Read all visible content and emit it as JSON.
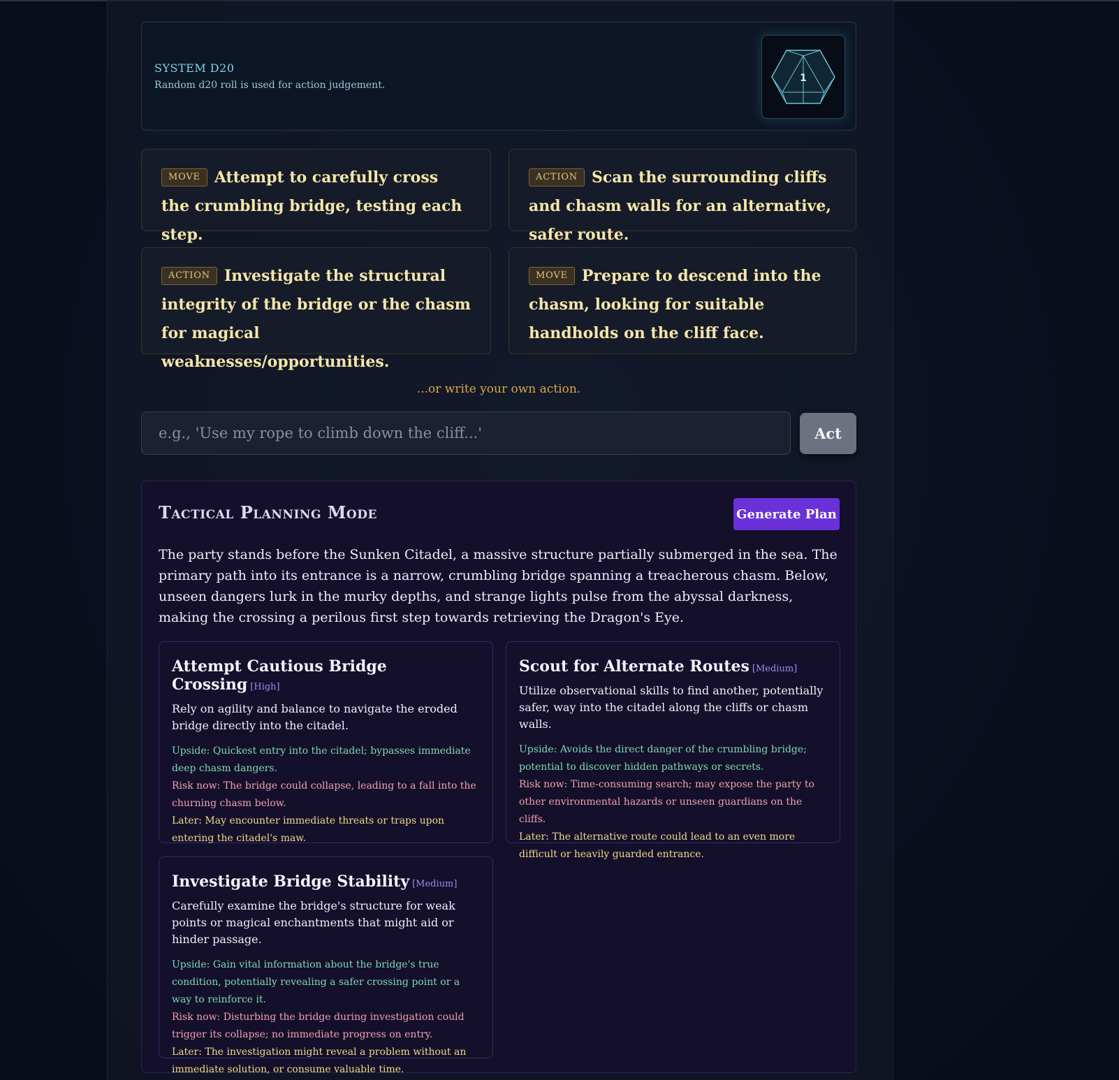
{
  "dice": {
    "title": "SYSTEM D20",
    "subtitle": "Random d20 roll is used for action judgement.",
    "icon": "d20-icon",
    "face_value": "1"
  },
  "options": [
    {
      "tag": "MOVE",
      "text": "Attempt to carefully cross the crumbling bridge, testing each step."
    },
    {
      "tag": "ACTION",
      "text": "Scan the surrounding cliffs and chasm walls for an alternative, safer route."
    },
    {
      "tag": "ACTION",
      "text": "Investigate the structural integrity of the bridge or the chasm for magical weaknesses/opportunities."
    },
    {
      "tag": "MOVE",
      "text": "Prepare to descend into the chasm, looking for suitable handholds on the cliff face."
    }
  ],
  "custom_action": {
    "prompt": "...or write your own action.",
    "placeholder": "e.g., 'Use my rope to climb down the cliff...'",
    "button_label": "Act"
  },
  "tactical": {
    "title": "Tactical Planning Mode",
    "button_label": "Generate Plan",
    "description": "The party stands before the Sunken Citadel, a massive structure partially submerged in the sea. The primary path into its entrance is a narrow, crumbling bridge spanning a treacherous chasm. Below, unseen dangers lurk in the murky depths, and strange lights pulse from the abyssal darkness, making the crossing a perilous first step towards retrieving the Dragon's Eye.",
    "plans": [
      {
        "title": "Attempt Cautious Bridge Crossing",
        "priority": "[High]",
        "description": "Rely on agility and balance to navigate the eroded bridge directly into the citadel.",
        "upside": "Upside: Quickest entry into the citadel; bypasses immediate deep chasm dangers.",
        "risk": "Risk now: The bridge could collapse, leading to a fall into the churning chasm below.",
        "later": "Later: May encounter immediate threats or traps upon entering the citadel's maw."
      },
      {
        "title": "Scout for Alternate Routes",
        "priority": "[Medium]",
        "description": "Utilize observational skills to find another, potentially safer, way into the citadel along the cliffs or chasm walls.",
        "upside": "Upside: Avoids the direct danger of the crumbling bridge; potential to discover hidden pathways or secrets.",
        "risk": "Risk now: Time-consuming search; may expose the party to other environmental hazards or unseen guardians on the cliffs.",
        "later": "Later: The alternative route could lead to an even more difficult or heavily guarded entrance."
      },
      {
        "title": "Investigate Bridge Stability",
        "priority": "[Medium]",
        "description": "Carefully examine the bridge's structure for weak points or magical enchantments that might aid or hinder passage.",
        "upside": "Upside: Gain vital information about the bridge's true condition, potentially revealing a safer crossing point or a way to reinforce it.",
        "risk": "Risk now: Disturbing the bridge during investigation could trigger its collapse; no immediate progress on entry.",
        "later": "Later: The investigation might reveal a problem without an immediate solution, or consume valuable time."
      }
    ]
  }
}
